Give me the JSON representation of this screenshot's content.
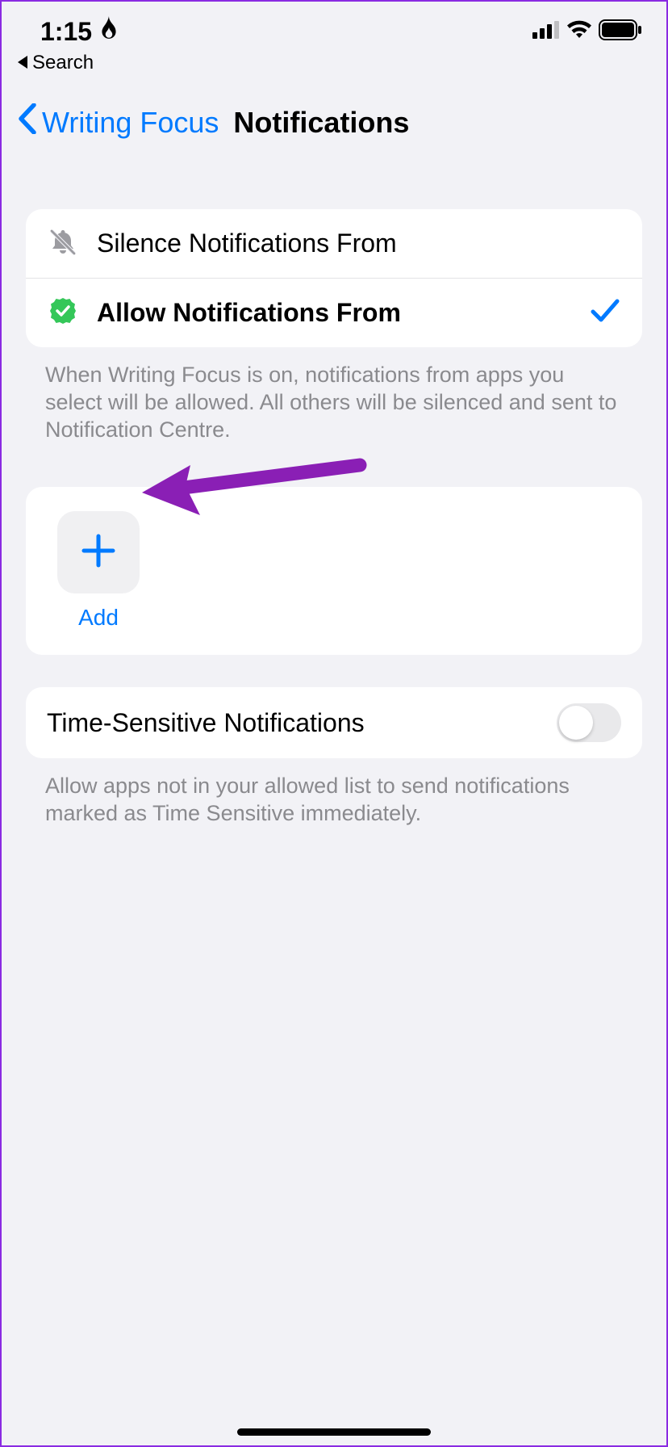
{
  "status": {
    "time": "1:15",
    "back_app": "Search"
  },
  "nav": {
    "back_label": "Writing Focus",
    "title": "Notifications"
  },
  "mode": {
    "silence_label": "Silence Notifications From",
    "allow_label": "Allow Notifications From",
    "footer": "When Writing Focus is on, notifications from apps you select will be allowed. All others will be silenced and sent to Notification Centre."
  },
  "add": {
    "label": "Add"
  },
  "time_sensitive": {
    "label": "Time-Sensitive Notifications",
    "footer": "Allow apps not in your allowed list to send notifications marked as Time Sensitive immediately."
  }
}
